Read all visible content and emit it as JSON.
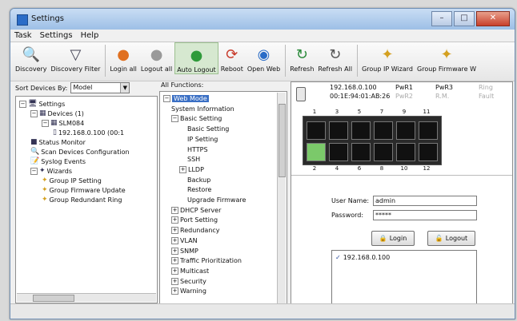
{
  "window": {
    "title": "Settings"
  },
  "menu": [
    "Task",
    "Settings",
    "Help"
  ],
  "toolbar": [
    {
      "label": "Discovery",
      "icon": "magnifier-icon"
    },
    {
      "label": "Discovery Filter",
      "icon": "funnel-icon"
    },
    {
      "label": "Login all",
      "icon": "user-login-icon"
    },
    {
      "label": "Logout all",
      "icon": "user-logout-icon"
    },
    {
      "label": "Auto Logout",
      "icon": "user-auto-logout-icon"
    },
    {
      "label": "Reboot",
      "icon": "reboot-icon"
    },
    {
      "label": "Open Web",
      "icon": "globe-icon"
    },
    {
      "label": "Refresh",
      "icon": "refresh-icon"
    },
    {
      "label": "Refresh All",
      "icon": "refresh-all-icon"
    },
    {
      "label": "Group IP Wizard",
      "icon": "wand-icon"
    },
    {
      "label": "Group Firmware W",
      "icon": "wand-icon"
    }
  ],
  "left": {
    "sort_label": "Sort Devices By:",
    "sort_value": "Model",
    "tree": [
      {
        "label": "Settings",
        "level": 0,
        "expander": "−",
        "icon": "computer-icon"
      },
      {
        "label": "Devices (1)",
        "level": 1,
        "expander": "−",
        "icon": "devices-icon"
      },
      {
        "label": "SLM084",
        "level": 2,
        "expander": "−",
        "icon": "switch-icon"
      },
      {
        "label": "192.168.0.100 (00:1",
        "level": 3,
        "expander": "",
        "icon": "device-icon"
      },
      {
        "label": "Status Monitor",
        "level": 1,
        "expander": "",
        "icon": "monitor-icon"
      },
      {
        "label": "Scan Devices Configuration",
        "level": 1,
        "expander": "",
        "icon": "scan-icon"
      },
      {
        "label": "Syslog Events",
        "level": 1,
        "expander": "",
        "icon": "syslog-icon"
      },
      {
        "label": "Wizards",
        "level": 1,
        "expander": "−",
        "icon": "wizard-icon"
      },
      {
        "label": "Group IP Setting",
        "level": 2,
        "expander": "",
        "icon": "wand-icon"
      },
      {
        "label": "Group Firmware Update",
        "level": 2,
        "expander": "",
        "icon": "wand-icon"
      },
      {
        "label": "Group Redundant Ring",
        "level": 2,
        "expander": "",
        "icon": "wand-icon"
      }
    ]
  },
  "functions": {
    "title": "All Functions:",
    "items": [
      {
        "label": "Web Mode",
        "level": 0,
        "expander": "−",
        "selected": true
      },
      {
        "label": "System Information",
        "level": 1,
        "expander": ""
      },
      {
        "label": "Basic Setting",
        "level": 1,
        "expander": "−"
      },
      {
        "label": "Basic Setting",
        "level": 2,
        "expander": ""
      },
      {
        "label": "IP Setting",
        "level": 2,
        "expander": ""
      },
      {
        "label": "HTTPS",
        "level": 2,
        "expander": ""
      },
      {
        "label": "SSH",
        "level": 2,
        "expander": ""
      },
      {
        "label": "LLDP",
        "level": 2,
        "expander": "+"
      },
      {
        "label": "Backup",
        "level": 2,
        "expander": ""
      },
      {
        "label": "Restore",
        "level": 2,
        "expander": ""
      },
      {
        "label": "Upgrade Firmware",
        "level": 2,
        "expander": ""
      },
      {
        "label": "DHCP Server",
        "level": 1,
        "expander": "+"
      },
      {
        "label": "Port Setting",
        "level": 1,
        "expander": "+"
      },
      {
        "label": "Redundancy",
        "level": 1,
        "expander": "+"
      },
      {
        "label": "VLAN",
        "level": 1,
        "expander": "+"
      },
      {
        "label": "SNMP",
        "level": 1,
        "expander": "+"
      },
      {
        "label": "Traffic Prioritization",
        "level": 1,
        "expander": "+"
      },
      {
        "label": "Multicast",
        "level": 1,
        "expander": "+"
      },
      {
        "label": "Security",
        "level": 1,
        "expander": "+"
      },
      {
        "label": "Warning",
        "level": 1,
        "expander": "+"
      }
    ]
  },
  "device": {
    "ip": "192.168.0.100",
    "mac": "00:1E:94:01:AB:26",
    "pwr1": "PwR1",
    "pwr2": "PwR2",
    "pwr3": "PwR3",
    "rm": "R.M.",
    "ring": "Ring",
    "fault": "Fault",
    "ports_top": [
      "1",
      "3",
      "5",
      "7",
      "9",
      "11"
    ],
    "ports_bottom": [
      "2",
      "4",
      "6",
      "8",
      "10",
      "12"
    ]
  },
  "login": {
    "user_label": "User Name:",
    "user_value": "admin",
    "password_label": "Password:",
    "password_value": "*****",
    "login_button": "Login",
    "logout_button": "Logout",
    "list_item": "192.168.0.100"
  }
}
